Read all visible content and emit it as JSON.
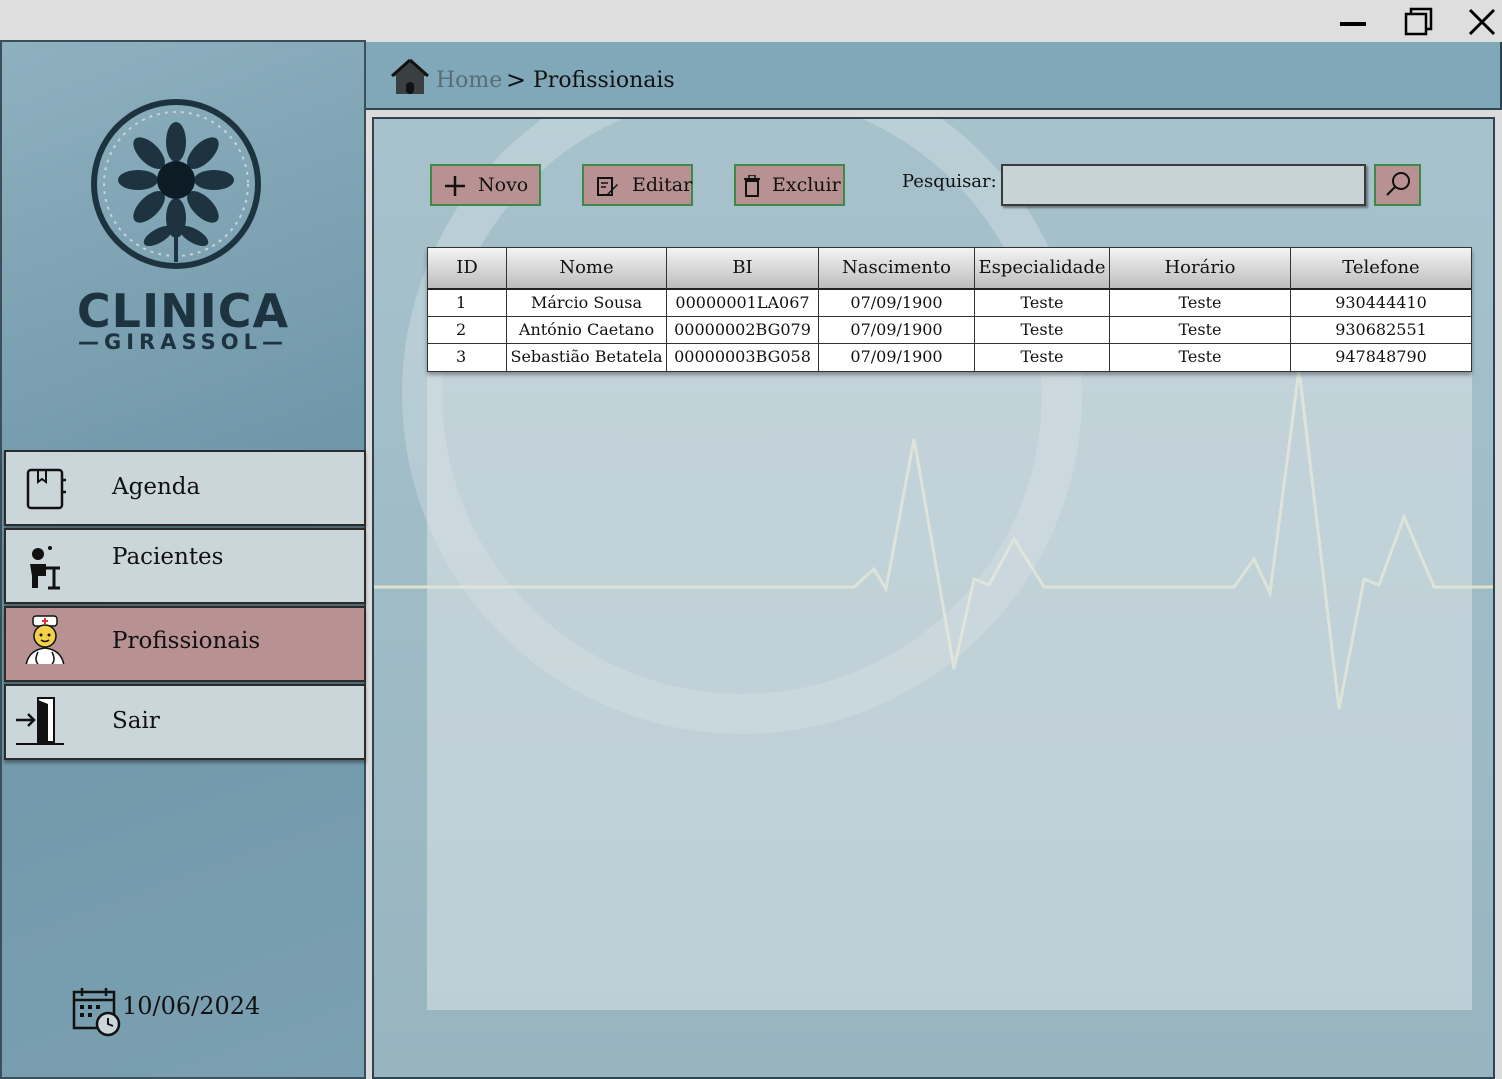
{
  "window": {
    "minimize_icon": "minimize-icon",
    "maximize_icon": "maximize-icon",
    "close_icon": "close-icon"
  },
  "sidebar": {
    "logo": {
      "title": "CLINICA",
      "subtitle": "GIRASSOL"
    },
    "items": [
      {
        "label": "Agenda",
        "icon": "notebook-icon",
        "active": false
      },
      {
        "label": "Pacientes",
        "icon": "patient-icon",
        "active": false
      },
      {
        "label": "Profissionais",
        "icon": "nurse-icon",
        "active": true
      },
      {
        "label": "Sair",
        "icon": "exit-door-icon",
        "active": false
      }
    ],
    "date": "10/06/2024"
  },
  "header": {
    "breadcrumb_home": "Home",
    "breadcrumb_separator": ">",
    "breadcrumb_current": "Profissionais"
  },
  "toolbar": {
    "new_label": "Novo",
    "edit_label": "Editar",
    "delete_label": "Excluir",
    "search_label": "Pesquisar:",
    "search_value": "",
    "search_placeholder": ""
  },
  "table": {
    "columns": [
      "ID",
      "Nome",
      "BI",
      "Nascimento",
      "Especialidade",
      "Horário",
      "Telefone"
    ],
    "rows": [
      [
        "1",
        "Márcio Sousa",
        "00000001LA067",
        "07/09/1900",
        "Teste",
        "Teste",
        "930444410"
      ],
      [
        "2",
        "António Caetano",
        "00000002BG079",
        "07/09/1900",
        "Teste",
        "Teste",
        "930682551"
      ],
      [
        "3",
        "Sebastião Betatela",
        "00000003BG058",
        "07/09/1900",
        "Teste",
        "Teste",
        "947848790"
      ]
    ]
  },
  "colors": {
    "sidebar_bg": "#7aa0b1",
    "active_nav": "#b89292",
    "button_bg": "#b89292",
    "button_border": "#3c8a45",
    "header_bg": "#80a8b9"
  }
}
